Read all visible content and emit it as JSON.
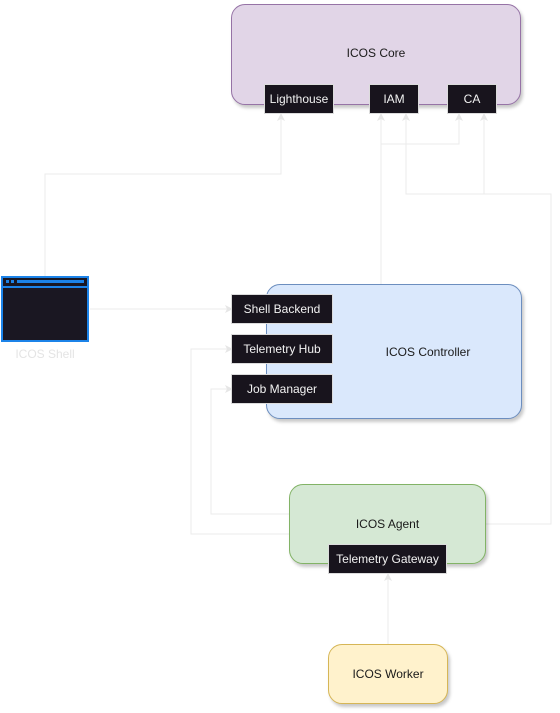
{
  "diagram": {
    "nodes": {
      "core": {
        "label": "ICOS Core",
        "fill": "#e1d5e7",
        "stroke": "#9673a6",
        "components": [
          {
            "label": "Lighthouse"
          },
          {
            "label": "IAM"
          },
          {
            "label": "CA"
          }
        ]
      },
      "controller": {
        "label": "ICOS Controller",
        "fill": "#dae8fc",
        "stroke": "#6c8ebf",
        "components": [
          {
            "label": "Shell Backend"
          },
          {
            "label": "Telemetry Hub"
          },
          {
            "label": "Job Manager"
          }
        ]
      },
      "agent": {
        "label": "ICOS Agent",
        "fill": "#d5e8d4",
        "stroke": "#82b366",
        "components": [
          {
            "label": "Telemetry Gateway"
          }
        ]
      },
      "worker": {
        "label": "ICOS Worker",
        "fill": "#fff2cc",
        "stroke": "#d6b656"
      },
      "shell": {
        "label": "ICOS Shell",
        "icon": "terminal-window-icon",
        "accent": "#1c83e8"
      }
    },
    "edges": [
      {
        "from": "ICOS Shell",
        "to": "Lighthouse"
      },
      {
        "from": "ICOS Shell",
        "to": "Shell Backend"
      },
      {
        "from": "ICOS Controller",
        "to": "IAM"
      },
      {
        "from": "ICOS Controller",
        "to": "CA"
      },
      {
        "from": "ICOS Agent",
        "to": "IAM"
      },
      {
        "from": "ICOS Agent",
        "to": "CA"
      },
      {
        "from": "ICOS Agent",
        "to": "Telemetry Hub"
      },
      {
        "from": "ICOS Agent",
        "to": "Job Manager"
      },
      {
        "from": "ICOS Worker",
        "to": "Telemetry Gateway"
      }
    ],
    "edge_color": "#ebebeb"
  }
}
